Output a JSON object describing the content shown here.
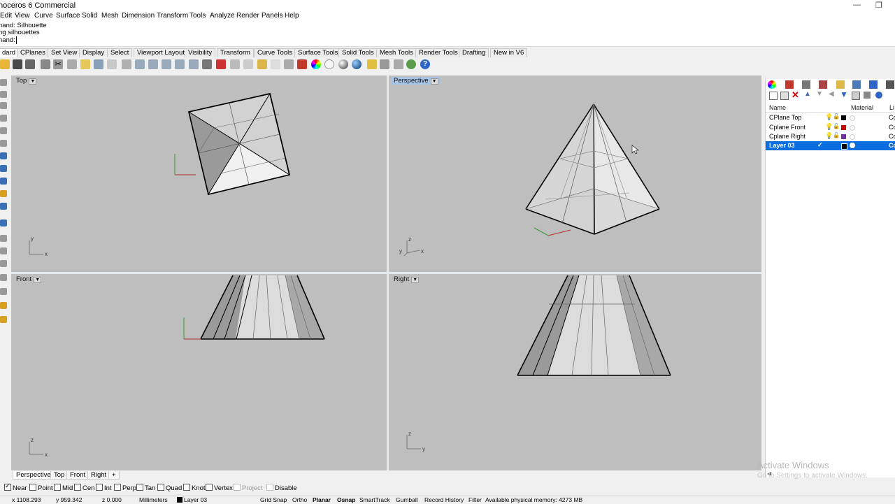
{
  "window": {
    "title": "noceros 6 Commercial",
    "minimize": "—",
    "restore": "❐"
  },
  "menu": [
    "Edit",
    "View",
    "Curve",
    "Surface",
    "Solid",
    "Mesh",
    "Dimension",
    "Transform",
    "Tools",
    "Analyze",
    "Render",
    "Panels",
    "Help"
  ],
  "command": {
    "history1": "nand: Silhouette",
    "history2": "ng silhouettes",
    "prompt": "nand:"
  },
  "tabs": [
    "dard",
    "CPlanes",
    "Set View",
    "Display",
    "Select",
    "Viewport Layout",
    "Visibility",
    "Transform",
    "Curve Tools",
    "Surface Tools",
    "Solid Tools",
    "Mesh Tools",
    "Render Tools",
    "Drafting",
    "New in V6"
  ],
  "viewports": {
    "top": {
      "label": "Top",
      "axis_y": "y",
      "axis_x": "x"
    },
    "perspective": {
      "label": "Perspective",
      "axis_z": "z",
      "axis_y": "y",
      "axis_x": "x"
    },
    "front": {
      "label": "Front",
      "axis_z": "z",
      "axis_x": "x"
    },
    "right": {
      "label": "Right",
      "axis_z": "z",
      "axis_y": "y"
    }
  },
  "bottom_tabs": [
    "Perspective",
    "Top",
    "Front",
    "Right",
    "+"
  ],
  "osnaps": [
    {
      "label": "Near",
      "checked": true
    },
    {
      "label": "Point",
      "checked": false
    },
    {
      "label": "Mid",
      "checked": false
    },
    {
      "label": "Cen",
      "checked": false
    },
    {
      "label": "Int",
      "checked": false
    },
    {
      "label": "Perp",
      "checked": false
    },
    {
      "label": "Tan",
      "checked": false
    },
    {
      "label": "Quad",
      "checked": false
    },
    {
      "label": "Knot",
      "checked": false
    },
    {
      "label": "Vertex",
      "checked": false
    },
    {
      "label": "Project",
      "checked": false
    },
    {
      "label": "Disable",
      "checked": false
    }
  ],
  "status": {
    "x": "x 1108.293",
    "y": "y 959.342",
    "z": "z 0.000",
    "units": "Millimeters",
    "layer": "Layer 03",
    "grid_snap": "Grid Snap",
    "ortho": "Ortho",
    "planar": "Planar",
    "osnap": "Osnap",
    "smarttrack": "SmartTrack",
    "gumball": "Gumball",
    "record_history": "Record History",
    "filter": "Filter",
    "memory": "Available physical memory: 4273 MB"
  },
  "layers_panel": {
    "col_name": "Name",
    "col_material": "Material",
    "col_linetype": "Li",
    "rows": [
      {
        "name": "CPlane Top",
        "color": "#000000",
        "linetype": "Co",
        "selected": false
      },
      {
        "name": "Cplane Front",
        "color": "#cc0000",
        "linetype": "Co",
        "selected": false
      },
      {
        "name": "Cplane Right",
        "color": "#7030a0",
        "linetype": "Co",
        "selected": false
      },
      {
        "name": "Layer 03",
        "color": "#000000",
        "linetype": "Co",
        "selected": true
      }
    ]
  },
  "watermark": {
    "line1": "Activate Windows",
    "line2": "Go to Settings to activate Windows."
  },
  "colors": {
    "viewport_bg": "#bebebe",
    "active_label": "#a7c4e6",
    "selection": "#0a6ee0"
  }
}
